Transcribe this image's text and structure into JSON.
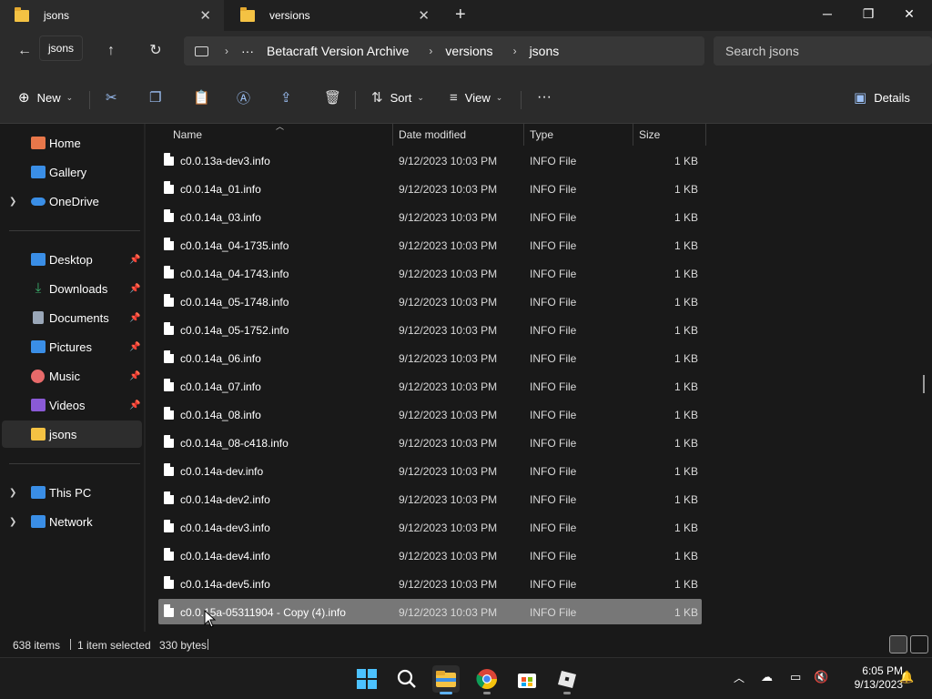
{
  "tabs": [
    {
      "label": "jsons",
      "active": true
    },
    {
      "label": "versions",
      "active": false
    }
  ],
  "window_controls": {
    "minimize": "─",
    "maximize": "❐",
    "close": "✕"
  },
  "nav": {
    "tooltip": "jsons"
  },
  "breadcrumb": {
    "overflow": "···",
    "items": [
      "Betacraft Version Archive",
      "versions",
      "jsons"
    ]
  },
  "search": {
    "placeholder": "Search jsons"
  },
  "commandbar": {
    "new_label": "New",
    "sort_label": "Sort",
    "view_label": "View",
    "more_label": "···",
    "details_label": "Details"
  },
  "sidebar": {
    "top": [
      {
        "label": "Home",
        "icon": "home-icon",
        "color": "#e8774a"
      },
      {
        "label": "Gallery",
        "icon": "gallery-icon",
        "color": "#3a8ee6"
      },
      {
        "label": "OneDrive",
        "icon": "onedrive-icon",
        "color": "#3a8ee6"
      }
    ],
    "pinned": [
      {
        "label": "Desktop",
        "icon": "desktop-icon",
        "color": "#3a8ee6"
      },
      {
        "label": "Downloads",
        "icon": "downloads-icon",
        "color": "#3bb26e"
      },
      {
        "label": "Documents",
        "icon": "documents-icon",
        "color": "#9aa7b8"
      },
      {
        "label": "Pictures",
        "icon": "pictures-icon",
        "color": "#3a8ee6"
      },
      {
        "label": "Music",
        "icon": "music-icon",
        "color": "#e86a6a"
      },
      {
        "label": "Videos",
        "icon": "videos-icon",
        "color": "#8a5ad6"
      },
      {
        "label": "jsons",
        "icon": "folder-icon",
        "color": "#f4c243"
      }
    ],
    "bottom": [
      {
        "label": "This PC",
        "icon": "this-pc-icon",
        "color": "#3a8ee6"
      },
      {
        "label": "Network",
        "icon": "network-icon",
        "color": "#3a8ee6"
      }
    ]
  },
  "columns": {
    "name": "Name",
    "date": "Date modified",
    "type": "Type",
    "size": "Size"
  },
  "files": [
    {
      "name": "c0.0.13a-dev3.info",
      "date": "9/12/2023 10:03 PM",
      "type": "INFO File",
      "size": "1 KB"
    },
    {
      "name": "c0.0.14a_01.info",
      "date": "9/12/2023 10:03 PM",
      "type": "INFO File",
      "size": "1 KB"
    },
    {
      "name": "c0.0.14a_03.info",
      "date": "9/12/2023 10:03 PM",
      "type": "INFO File",
      "size": "1 KB"
    },
    {
      "name": "c0.0.14a_04-1735.info",
      "date": "9/12/2023 10:03 PM",
      "type": "INFO File",
      "size": "1 KB"
    },
    {
      "name": "c0.0.14a_04-1743.info",
      "date": "9/12/2023 10:03 PM",
      "type": "INFO File",
      "size": "1 KB"
    },
    {
      "name": "c0.0.14a_05-1748.info",
      "date": "9/12/2023 10:03 PM",
      "type": "INFO File",
      "size": "1 KB"
    },
    {
      "name": "c0.0.14a_05-1752.info",
      "date": "9/12/2023 10:03 PM",
      "type": "INFO File",
      "size": "1 KB"
    },
    {
      "name": "c0.0.14a_06.info",
      "date": "9/12/2023 10:03 PM",
      "type": "INFO File",
      "size": "1 KB"
    },
    {
      "name": "c0.0.14a_07.info",
      "date": "9/12/2023 10:03 PM",
      "type": "INFO File",
      "size": "1 KB"
    },
    {
      "name": "c0.0.14a_08.info",
      "date": "9/12/2023 10:03 PM",
      "type": "INFO File",
      "size": "1 KB"
    },
    {
      "name": "c0.0.14a_08-c418.info",
      "date": "9/12/2023 10:03 PM",
      "type": "INFO File",
      "size": "1 KB"
    },
    {
      "name": "c0.0.14a-dev.info",
      "date": "9/12/2023 10:03 PM",
      "type": "INFO File",
      "size": "1 KB"
    },
    {
      "name": "c0.0.14a-dev2.info",
      "date": "9/12/2023 10:03 PM",
      "type": "INFO File",
      "size": "1 KB"
    },
    {
      "name": "c0.0.14a-dev3.info",
      "date": "9/12/2023 10:03 PM",
      "type": "INFO File",
      "size": "1 KB"
    },
    {
      "name": "c0.0.14a-dev4.info",
      "date": "9/12/2023 10:03 PM",
      "type": "INFO File",
      "size": "1 KB"
    },
    {
      "name": "c0.0.14a-dev5.info",
      "date": "9/12/2023 10:03 PM",
      "type": "INFO File",
      "size": "1 KB"
    },
    {
      "name": "c0.0.15a-05311904 - Copy (4).info",
      "date": "9/12/2023 10:03 PM",
      "type": "INFO File",
      "size": "1 KB",
      "selected": true
    }
  ],
  "status": {
    "items": "638 items",
    "selected": "1 item selected",
    "bytes": "330 bytes"
  },
  "clock": {
    "time": "6:05 PM",
    "date": "9/13/2023"
  }
}
